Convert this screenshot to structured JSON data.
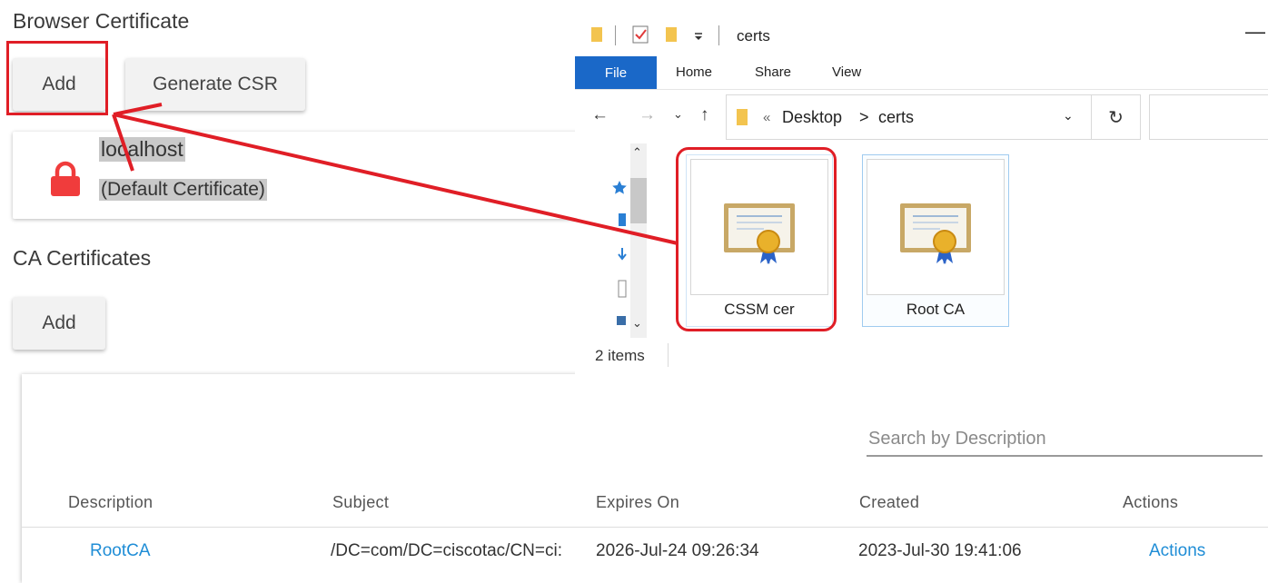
{
  "browser_cert": {
    "title": "Browser Certificate",
    "add_label": "Add",
    "csr_label": "Generate CSR",
    "cert_name": "localhost",
    "cert_sub": "(Default Certificate)"
  },
  "ca_certs": {
    "title": "CA Certificates",
    "add_label": "Add",
    "search_placeholder": "Search by Description",
    "columns": [
      "Description",
      "Subject",
      "Expires On",
      "Created",
      "Actions"
    ],
    "rows": [
      {
        "description": "RootCA",
        "subject": "/DC=com/DC=ciscotac/CN=ci:",
        "expires": "2026-Jul-24 09:26:34",
        "created": "2023-Jul-30 19:41:06",
        "actions": "Actions"
      }
    ]
  },
  "explorer": {
    "title": "certs",
    "minimize": "—",
    "ribbon": {
      "file": "File",
      "home": "Home",
      "share": "Share",
      "view": "View"
    },
    "address": {
      "prefix": "«",
      "desktop": "Desktop",
      "separator": ">",
      "folder": "certs"
    },
    "files": [
      {
        "name": "CSSM cer"
      },
      {
        "name": "Root CA"
      }
    ],
    "status": "2 items"
  },
  "colors": {
    "highlight": "#e01e26",
    "link": "#1f8dd6",
    "ribbon_file": "#1a68c8"
  }
}
